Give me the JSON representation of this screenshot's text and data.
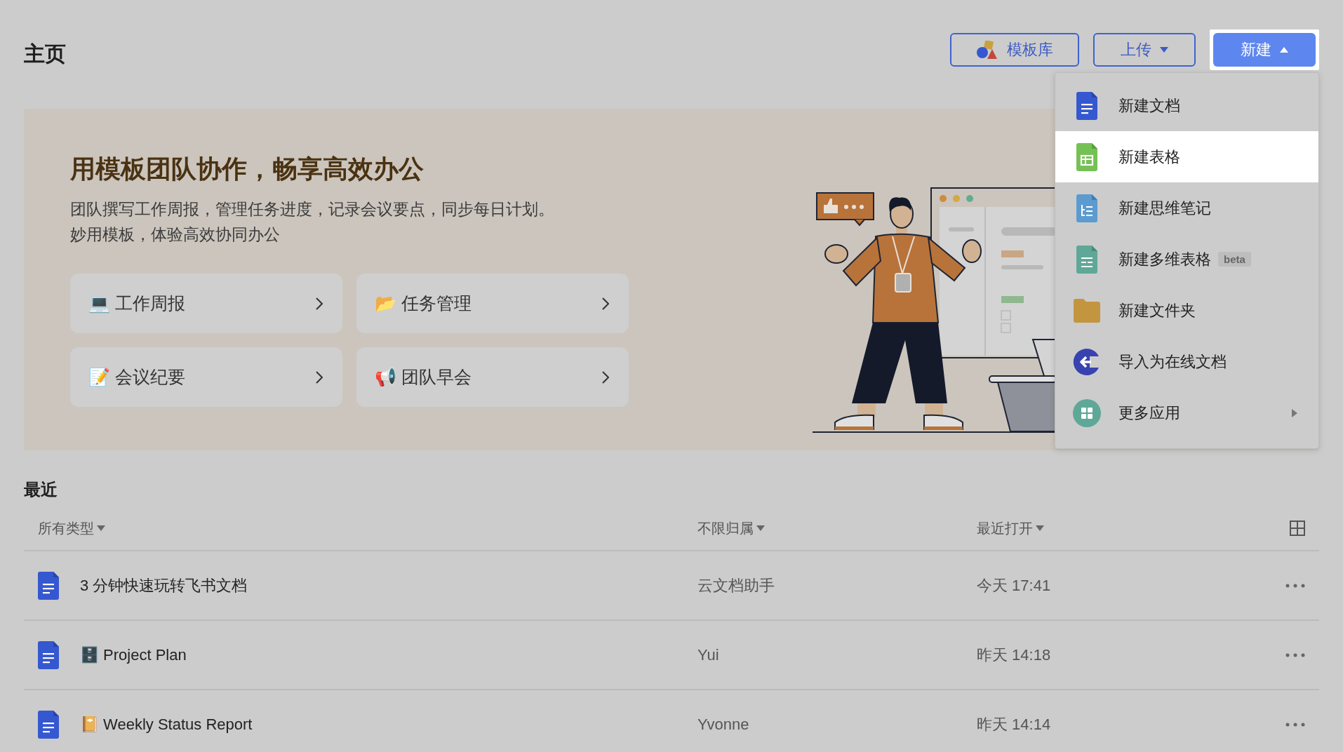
{
  "page_title": "主页",
  "toolbar": {
    "buttons": [
      {
        "kind": "template",
        "label": "模板库"
      },
      {
        "kind": "upload",
        "label": "上传",
        "expanded": false
      },
      {
        "kind": "new",
        "label": "新建",
        "expanded": true
      }
    ]
  },
  "banner": {
    "heading": "用模板团队协作，畅享高效办公",
    "description": [
      "团队撰写工作周报，管理任务进度，记录会议要点，同步每日计划。",
      "妙用模板，体验高效协同办公"
    ],
    "templates": [
      {
        "label": "💻 工作周报"
      },
      {
        "label": "📂 任务管理"
      },
      {
        "label": "📝 会议纪要"
      },
      {
        "label": "📢 团队早会"
      }
    ]
  },
  "new_menu": {
    "items": [
      {
        "kind": "doc",
        "label": "新建文档",
        "selected": false
      },
      {
        "kind": "sheet",
        "label": "新建表格",
        "selected": true
      },
      {
        "kind": "mindnote",
        "label": "新建思维笔记",
        "selected": false
      },
      {
        "kind": "bitable",
        "label": "新建多维表格",
        "badge": "beta",
        "selected": false
      },
      {
        "kind": "folder",
        "label": "新建文件夹",
        "selected": false
      },
      {
        "kind": "import",
        "label": "导入为在线文档",
        "selected": false
      },
      {
        "kind": "more",
        "label": "更多应用",
        "submenu": true,
        "selected": false
      }
    ]
  },
  "recent": {
    "title": "最近",
    "filters": [
      {
        "label": "所有类型"
      },
      {
        "label": "不限归属"
      },
      {
        "label": "最近打开"
      }
    ],
    "rows": [
      {
        "name": "3 分钟快速玩转飞书文档",
        "owner": "云文档助手",
        "opened": "今天 17:41"
      },
      {
        "name": "🗄️ Project Plan",
        "owner": "Yui",
        "opened": "昨天 14:18"
      },
      {
        "name": "📔 Weekly Status Report",
        "owner": "Yvonne",
        "opened": "昨天 14:14"
      }
    ]
  }
}
